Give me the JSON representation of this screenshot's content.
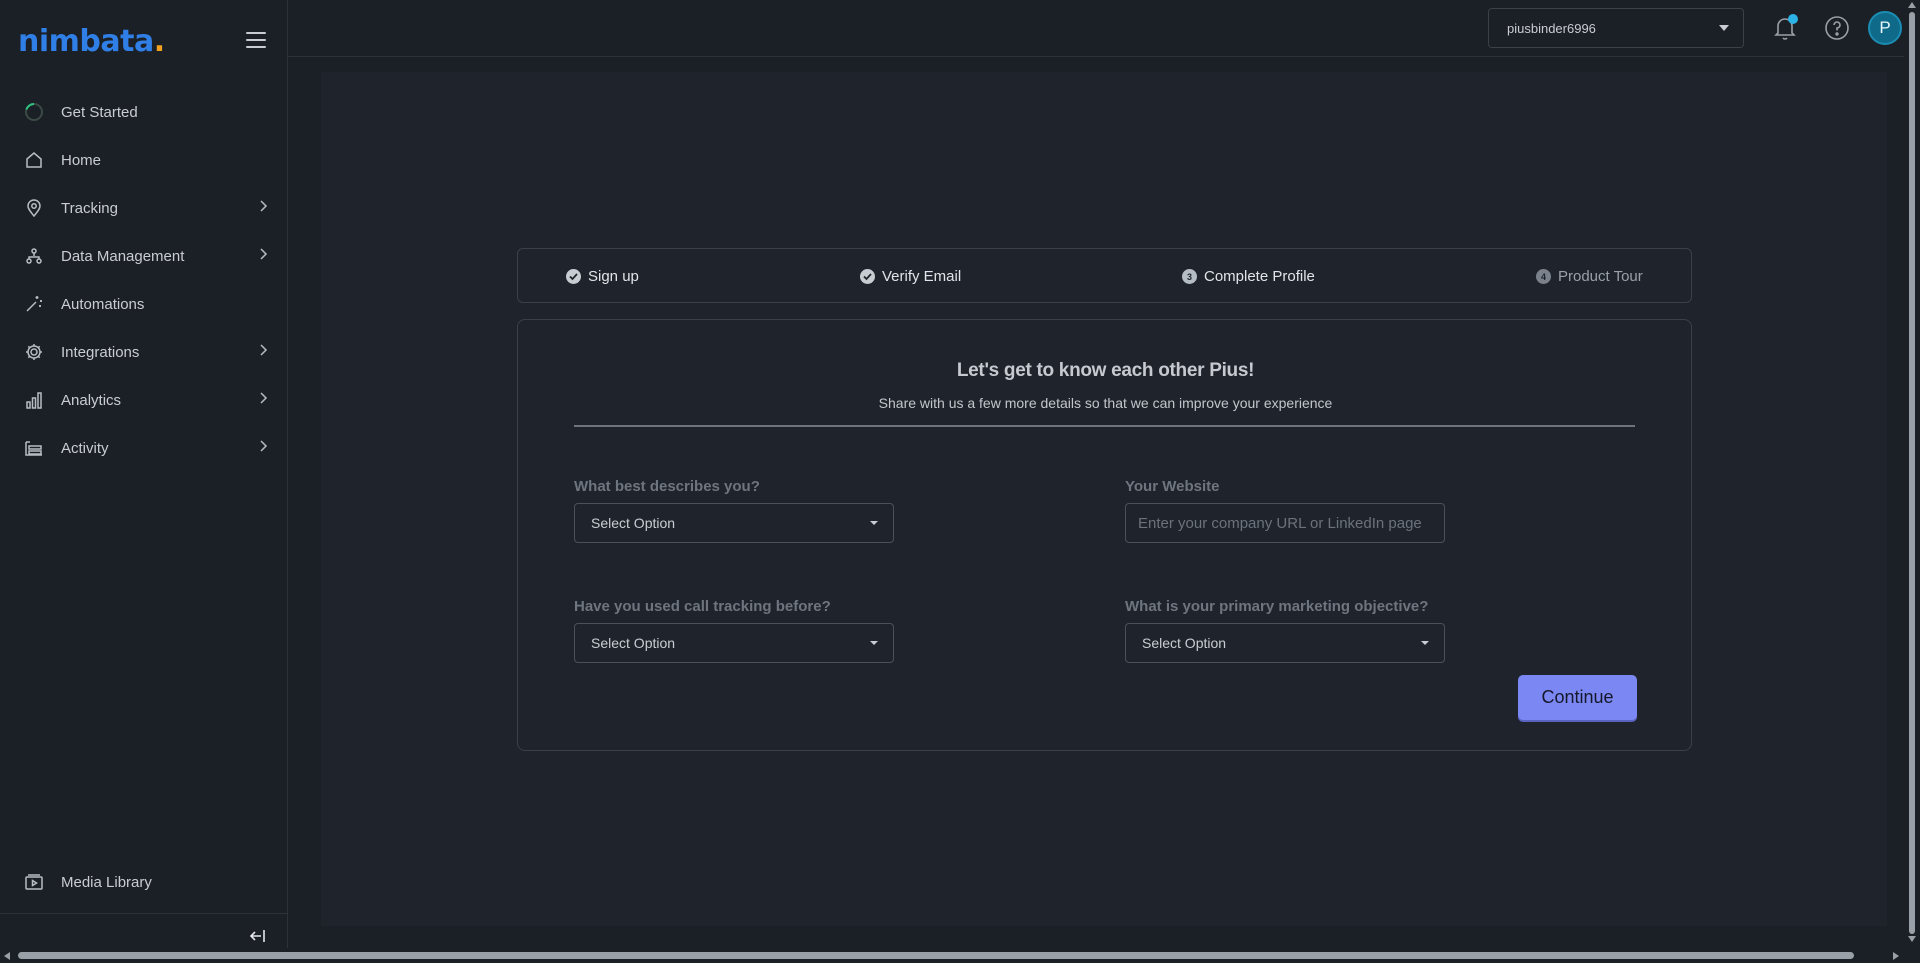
{
  "brand": {
    "name": "nimbata",
    "dot": ".",
    "color": "#2f7fe6",
    "dot_color": "#f0a11f"
  },
  "sidebar": {
    "items": [
      {
        "label": "Get Started",
        "icon": "progress-ring-icon",
        "has_submenu": false
      },
      {
        "label": "Home",
        "icon": "home-icon",
        "has_submenu": false
      },
      {
        "label": "Tracking",
        "icon": "location-pin-icon",
        "has_submenu": true
      },
      {
        "label": "Data Management",
        "icon": "hierarchy-icon",
        "has_submenu": true
      },
      {
        "label": "Automations",
        "icon": "magic-wand-icon",
        "has_submenu": false
      },
      {
        "label": "Integrations",
        "icon": "gear-icon",
        "has_submenu": true
      },
      {
        "label": "Analytics",
        "icon": "bar-chart-icon",
        "has_submenu": true
      },
      {
        "label": "Activity",
        "icon": "activity-list-icon",
        "has_submenu": true
      }
    ],
    "media_library": {
      "label": "Media Library",
      "icon": "media-library-icon"
    }
  },
  "header": {
    "account": "piusbinder6996",
    "avatar_initial": "P",
    "notification_badge_color": "#2bb3e6"
  },
  "stepper": {
    "steps": [
      {
        "label": "Sign up",
        "state": "done",
        "mark": ""
      },
      {
        "label": "Verify Email",
        "state": "done",
        "mark": ""
      },
      {
        "label": "Complete Profile",
        "state": "current",
        "mark": "3"
      },
      {
        "label": "Product Tour",
        "state": "pending",
        "mark": "4"
      }
    ]
  },
  "form": {
    "title": "Let's get to know each other Pius!",
    "subtitle": "Share with us a few more details so that we can improve your experience",
    "describes_you": {
      "label": "What best describes you?",
      "value": "Select Option"
    },
    "website": {
      "label": "Your Website",
      "placeholder": "Enter your company URL or LinkedIn page"
    },
    "call_tracking": {
      "label": "Have you used call tracking before?",
      "value": "Select Option"
    },
    "objective": {
      "label": "What is your primary marketing objective?",
      "value": "Select Option"
    },
    "continue_label": "Continue",
    "accent_color": "#7b87f2"
  }
}
